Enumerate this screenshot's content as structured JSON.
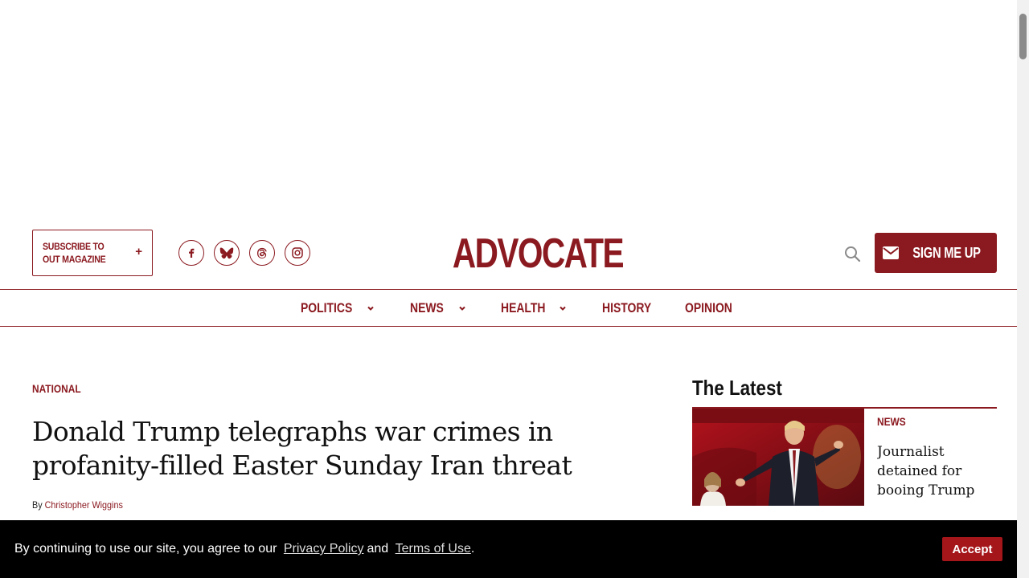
{
  "header": {
    "subscribe_label": "SUBSCRIBE TO OUT MAGAZINE",
    "subscribe_plus": "+",
    "logo": "ADVOCATE",
    "signup_label": "SIGN ME UP",
    "social": [
      "facebook-icon",
      "bluesky-icon",
      "threads-icon",
      "instagram-icon"
    ]
  },
  "nav": {
    "items": [
      {
        "label": "POLITICS",
        "has_dropdown": true
      },
      {
        "label": "NEWS",
        "has_dropdown": true
      },
      {
        "label": "HEALTH",
        "has_dropdown": true
      },
      {
        "label": "HISTORY",
        "has_dropdown": false
      },
      {
        "label": "OPINION",
        "has_dropdown": false
      }
    ]
  },
  "article": {
    "kicker": "NATIONAL",
    "headline": "Donald Trump telegraphs war crimes in profanity-filled Easter Sunday Iran threat",
    "by": "By",
    "author": "Christopher Wiggins"
  },
  "latest": {
    "title": "The Latest",
    "items": [
      {
        "category": "NEWS",
        "headline": "Journalist detained for booing Trump a..."
      }
    ]
  },
  "cookie": {
    "text_before": "By continuing to use our site, you agree to our",
    "privacy": "Privacy Policy",
    "and": "and",
    "terms": "Terms of Use",
    "period": ".",
    "accept": "Accept"
  },
  "colors": {
    "brand": "#8b1a20",
    "banner_bg": "#000000",
    "accept_bg": "#a5161b"
  }
}
